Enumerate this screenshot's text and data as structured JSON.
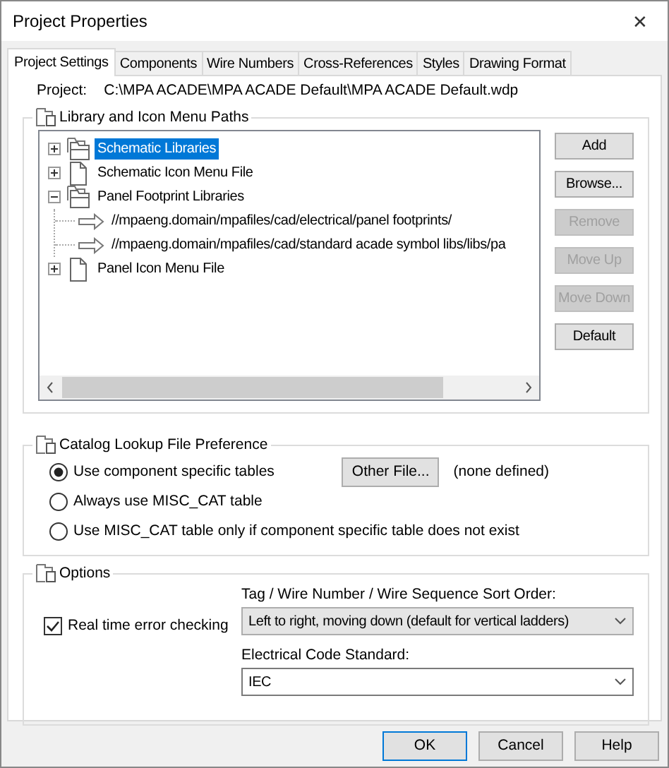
{
  "window": {
    "title": "Project Properties",
    "close": "✕"
  },
  "tabs": [
    {
      "label": "Project Settings",
      "selected": true
    },
    {
      "label": "Components",
      "selected": false
    },
    {
      "label": "Wire Numbers",
      "selected": false
    },
    {
      "label": "Cross-References",
      "selected": false
    },
    {
      "label": "Styles",
      "selected": false
    },
    {
      "label": "Drawing Format",
      "selected": false
    }
  ],
  "project": {
    "label": "Project:",
    "path": "C:\\MPA ACADE\\MPA ACADE Default\\MPA ACADE Default.wdp"
  },
  "library_paths": {
    "title": "Library and Icon Menu Paths",
    "tree": [
      {
        "kind": "folders",
        "label": "Schematic Libraries",
        "expanded": false,
        "selected": true
      },
      {
        "kind": "file",
        "label": "Schematic Icon Menu File",
        "expanded": false,
        "selected": false
      },
      {
        "kind": "folders",
        "label": "Panel Footprint Libraries",
        "expanded": true,
        "selected": false,
        "children": [
          {
            "kind": "path",
            "label": "//mpaeng.domain/mpafiles/cad/electrical/panel footprints/",
            "selected": false
          },
          {
            "kind": "path",
            "label": "//mpaeng.domain/mpafiles/cad/standard acade symbol libs/libs/pa",
            "selected": false
          }
        ]
      },
      {
        "kind": "file",
        "label": "Panel Icon Menu File",
        "expanded": false,
        "selected": false
      }
    ],
    "buttons": [
      {
        "label": "Add",
        "disabled": false
      },
      {
        "label": "Browse...",
        "disabled": false
      },
      {
        "label": "Remove",
        "disabled": true
      },
      {
        "label": "Move Up",
        "disabled": true
      },
      {
        "label": "Move Down",
        "disabled": true
      },
      {
        "label": "Default",
        "disabled": false
      }
    ]
  },
  "catalog": {
    "title": "Catalog Lookup File Preference",
    "options": [
      {
        "label": "Use component specific tables",
        "selected": true
      },
      {
        "label": "Always use MISC_CAT table",
        "selected": false
      },
      {
        "label": "Use MISC_CAT table only if component specific table does not exist",
        "selected": false
      }
    ],
    "other_file_button": "Other File...",
    "other_file_value": "(none defined)"
  },
  "options": {
    "title": "Options",
    "real_time_checking": {
      "label": "Real time error checking",
      "checked": true
    },
    "sort_order": {
      "label": "Tag / Wire Number / Wire Sequence Sort Order:",
      "value": "Left to right, moving down (default for vertical ladders)"
    },
    "code_standard": {
      "label": "Electrical Code Standard:",
      "value": "IEC"
    }
  },
  "buttons": [
    {
      "label": "OK",
      "default": true
    },
    {
      "label": "Cancel",
      "default": false
    },
    {
      "label": "Help",
      "default": false
    }
  ]
}
